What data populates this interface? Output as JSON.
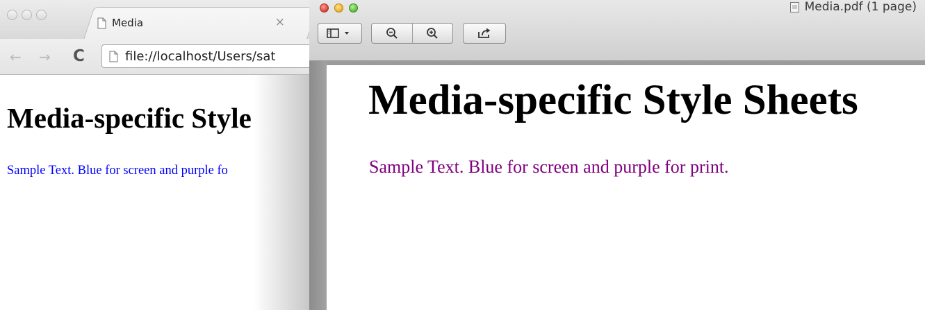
{
  "browser": {
    "tab_title": "Media",
    "tab_close": "×",
    "back_glyph": "←",
    "forward_glyph": "→",
    "reload_glyph": "C",
    "url": "file://localhost/Users/sat",
    "page": {
      "heading": "Media-specific Style",
      "text": "Sample Text. Blue for screen and purple fo",
      "text_color": "#0000ff"
    }
  },
  "preview": {
    "window_title": "Media.pdf (1 page)",
    "toolbar": {
      "sidebar_icon": "sidebar-view-icon",
      "zoom_out_icon": "zoom-out-icon",
      "zoom_in_icon": "zoom-in-icon",
      "share_icon": "share-icon"
    },
    "page": {
      "heading": "Media-specific Style Sheets",
      "text": "Sample Text. Blue for screen and purple for print.",
      "text_color": "#800080"
    }
  },
  "colors": {
    "traffic_red": "#e0433a",
    "traffic_yellow": "#f0b12b",
    "traffic_green": "#5cc13c"
  }
}
